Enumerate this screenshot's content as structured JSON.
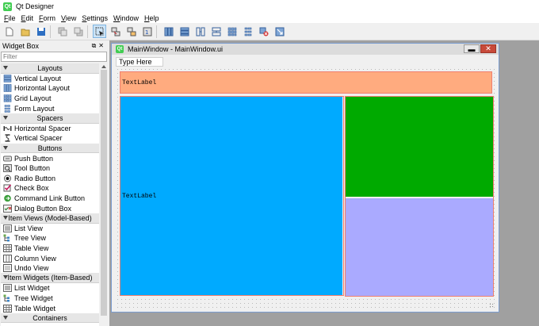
{
  "app": {
    "title": "Qt Designer",
    "icon_text": "Qt"
  },
  "menu": [
    "File",
    "Edit",
    "Form",
    "View",
    "Settings",
    "Window",
    "Help"
  ],
  "toolbar": [
    {
      "icon": "new-form-icon"
    },
    {
      "icon": "open-icon"
    },
    {
      "icon": "save-icon"
    },
    {
      "sep": true
    },
    {
      "icon": "send-to-back-icon"
    },
    {
      "icon": "bring-to-front-icon"
    },
    {
      "sep": true
    },
    {
      "icon": "edit-widgets-icon"
    },
    {
      "icon": "edit-signals-slots-icon"
    },
    {
      "icon": "edit-buddies-icon"
    },
    {
      "icon": "edit-tab-order-icon"
    },
    {
      "sep": true
    },
    {
      "icon": "layout-horizontal-icon"
    },
    {
      "icon": "layout-vertical-icon"
    },
    {
      "icon": "layout-h-splitter-icon"
    },
    {
      "icon": "layout-v-splitter-icon"
    },
    {
      "icon": "layout-grid-icon"
    },
    {
      "icon": "layout-form-icon"
    },
    {
      "icon": "break-layout-icon"
    },
    {
      "icon": "adjust-size-icon"
    }
  ],
  "widget_box": {
    "title": "Widget Box",
    "filter_placeholder": "Filter",
    "sections": [
      {
        "name": "Layouts",
        "items": [
          {
            "label": "Vertical Layout",
            "icon": "vertical-layout-icon"
          },
          {
            "label": "Horizontal Layout",
            "icon": "horizontal-layout-icon"
          },
          {
            "label": "Grid Layout",
            "icon": "grid-layout-icon"
          },
          {
            "label": "Form Layout",
            "icon": "form-layout-icon"
          }
        ]
      },
      {
        "name": "Spacers",
        "items": [
          {
            "label": "Horizontal Spacer",
            "icon": "horizontal-spacer-icon"
          },
          {
            "label": "Vertical Spacer",
            "icon": "vertical-spacer-icon"
          }
        ]
      },
      {
        "name": "Buttons",
        "items": [
          {
            "label": "Push Button",
            "icon": "push-button-icon"
          },
          {
            "label": "Tool Button",
            "icon": "tool-button-icon"
          },
          {
            "label": "Radio Button",
            "icon": "radio-button-icon"
          },
          {
            "label": "Check Box",
            "icon": "check-box-icon"
          },
          {
            "label": "Command Link Button",
            "icon": "command-link-icon"
          },
          {
            "label": "Dialog Button Box",
            "icon": "dialog-button-box-icon"
          }
        ]
      },
      {
        "name": "Item Views (Model-Based)",
        "items": [
          {
            "label": "List View",
            "icon": "list-view-icon"
          },
          {
            "label": "Tree View",
            "icon": "tree-view-icon"
          },
          {
            "label": "Table View",
            "icon": "table-view-icon"
          },
          {
            "label": "Column View",
            "icon": "column-view-icon"
          },
          {
            "label": "Undo View",
            "icon": "undo-view-icon"
          }
        ]
      },
      {
        "name": "Item Widgets (Item-Based)",
        "items": [
          {
            "label": "List Widget",
            "icon": "list-widget-icon"
          },
          {
            "label": "Tree Widget",
            "icon": "tree-widget-icon"
          },
          {
            "label": "Table Widget",
            "icon": "table-widget-icon"
          }
        ]
      },
      {
        "name": "Containers",
        "items": []
      }
    ]
  },
  "form_window": {
    "title": "MainWindow - MainWindow.ui",
    "icon_text": "Qt",
    "menu_placeholder": "Type Here",
    "labels": {
      "top": "TextLabel",
      "left": "TextLabel"
    },
    "colors": {
      "top": "#ffab7f",
      "left": "#00aaff",
      "green": "#00aa00",
      "lilac": "#aaaaff",
      "selection": "#ef7f6f"
    }
  }
}
